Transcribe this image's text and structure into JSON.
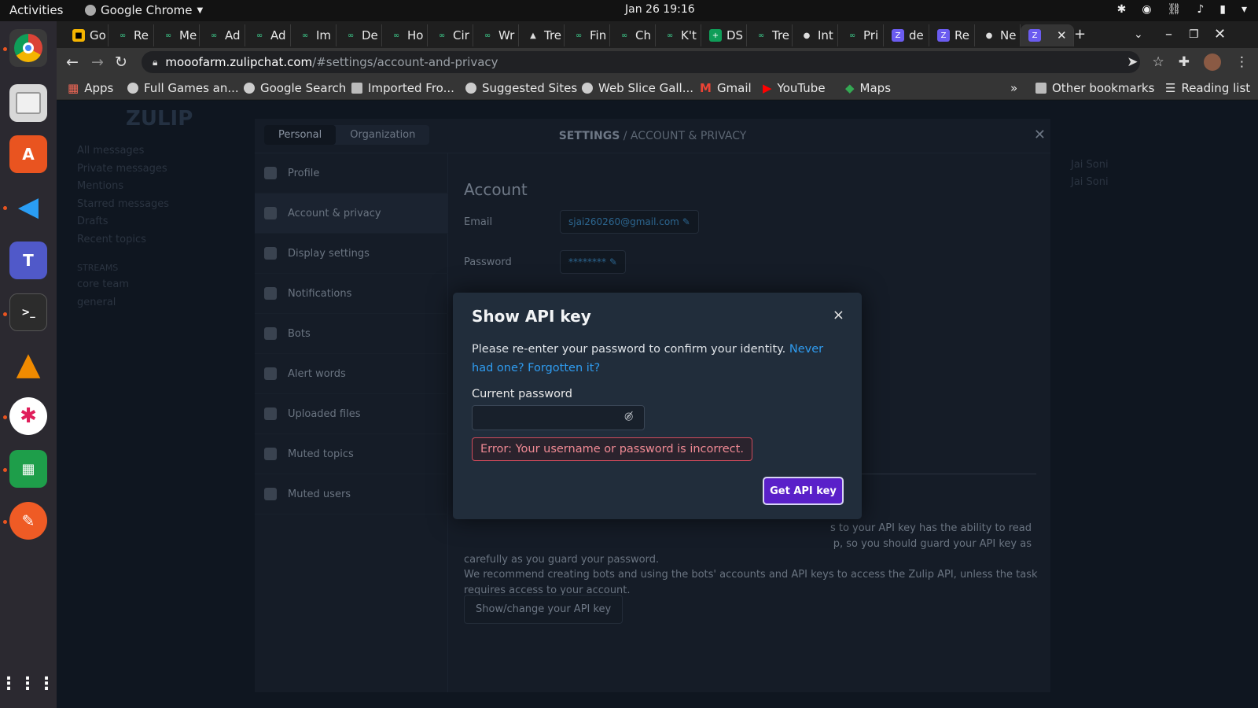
{
  "topbar": {
    "activities": "Activities",
    "app_name": "Google Chrome",
    "clock": "Jan 26  19:16"
  },
  "tabs": [
    {
      "label": "Go"
    },
    {
      "label": "Re"
    },
    {
      "label": "Me"
    },
    {
      "label": "Ad"
    },
    {
      "label": "Ad"
    },
    {
      "label": "Im"
    },
    {
      "label": "De"
    },
    {
      "label": "Ho"
    },
    {
      "label": "Cir"
    },
    {
      "label": "Wr"
    },
    {
      "label": "Tre"
    },
    {
      "label": "Fin"
    },
    {
      "label": "Ch"
    },
    {
      "label": "K't"
    },
    {
      "label": "DS"
    },
    {
      "label": "Tre"
    },
    {
      "label": "Int"
    },
    {
      "label": "Pri"
    },
    {
      "label": "de"
    },
    {
      "label": "Re"
    },
    {
      "label": "Ne"
    }
  ],
  "address": {
    "host": "mooofarm.zulipchat.com",
    "path": "/#settings/account-and-privacy"
  },
  "bookmarks": [
    {
      "label": "Apps"
    },
    {
      "label": "Full Games an..."
    },
    {
      "label": "Google Search"
    },
    {
      "label": "Imported Fro..."
    },
    {
      "label": "Suggested Sites"
    },
    {
      "label": "Web Slice Gall..."
    },
    {
      "label": "Gmail"
    },
    {
      "label": "YouTube"
    },
    {
      "label": "Maps"
    }
  ],
  "bookmarks_right": {
    "more": "»",
    "other": "Other bookmarks",
    "reading": "Reading list"
  },
  "settings": {
    "tab_personal": "Personal",
    "tab_organization": "Organization",
    "title_main": "SETTINGS",
    "title_sub": " / ACCOUNT & PRIVACY",
    "sidebar": [
      {
        "label": "Profile"
      },
      {
        "label": "Account & privacy"
      },
      {
        "label": "Display settings"
      },
      {
        "label": "Notifications"
      },
      {
        "label": "Bots"
      },
      {
        "label": "Alert words"
      },
      {
        "label": "Uploaded files"
      },
      {
        "label": "Muted topics"
      },
      {
        "label": "Muted users"
      }
    ],
    "account_heading": "Account",
    "email_label": "Email",
    "email_value": "sjai260260@gmail.com",
    "password_label": "Password",
    "password_value": "********",
    "api_text_1": "s to your API key has the ability to read",
    "api_text_2": "p, so you should guard your API key as",
    "api_text_3": "carefully as you guard your password.",
    "api_text_4": "We recommend creating bots and using the bots' accounts and API keys to access the Zulip API, unless the task requires access to your account.",
    "api_button": "Show/change your API key"
  },
  "background": {
    "logo": "ZULIP",
    "left_items": [
      "All messages",
      "Private messages",
      "Mentions",
      "Starred messages",
      "Drafts",
      "Recent topics",
      "STREAMS",
      "core team",
      "general"
    ],
    "right_items": [
      "Jai Soni",
      "Jai Soni"
    ]
  },
  "modal": {
    "title": "Show API key",
    "close": "×",
    "message": "Please re-enter your password to confirm your identity. ",
    "link": "Never had one? Forgotten it?",
    "password_label": "Current password",
    "error": "Error: Your username or password is incorrect.",
    "submit": "Get API key"
  }
}
